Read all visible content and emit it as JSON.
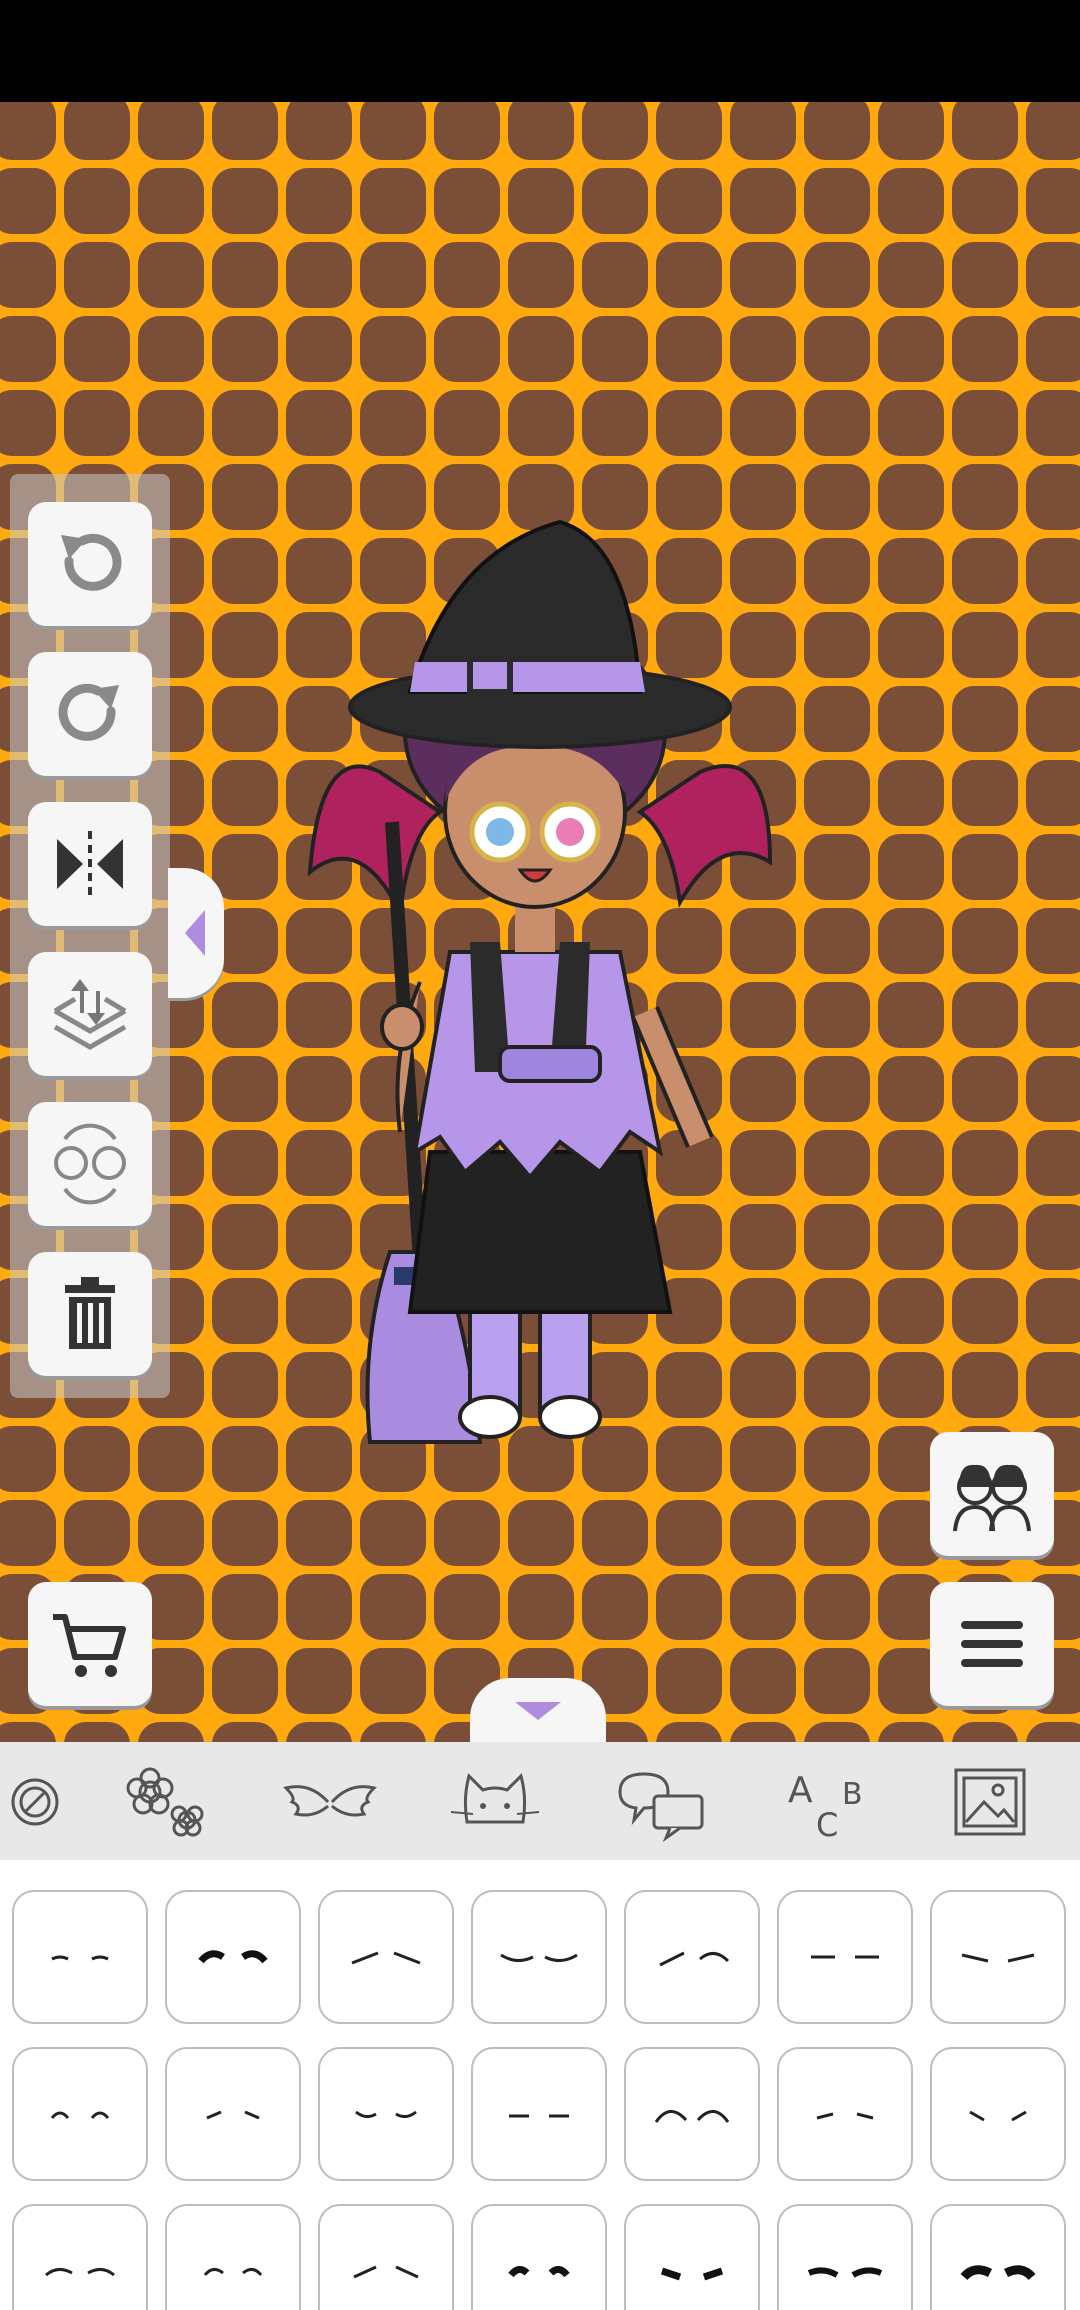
{
  "app": {
    "screen": "character-editor"
  },
  "toolbar": {
    "tools": [
      {
        "name": "undo-button",
        "icon": "undo-icon"
      },
      {
        "name": "redo-button",
        "icon": "redo-icon"
      },
      {
        "name": "flip-button",
        "icon": "flip-horizontal-icon"
      },
      {
        "name": "layer-order-button",
        "icon": "layer-order-icon"
      },
      {
        "name": "swap-character-button",
        "icon": "swap-character-icon"
      },
      {
        "name": "delete-button",
        "icon": "trash-icon"
      }
    ]
  },
  "buttons": {
    "characters": "characters-icon",
    "shop": "cart-icon",
    "menu": "hamburger-menu-icon"
  },
  "categories": [
    {
      "icon": "circle-accessory-icon"
    },
    {
      "icon": "flowers-icon"
    },
    {
      "icon": "wings-icon"
    },
    {
      "icon": "cat-pet-icon"
    },
    {
      "icon": "speech-bubble-icon"
    },
    {
      "icon": "text-abc-icon"
    },
    {
      "icon": "background-image-icon"
    }
  ],
  "eyebrow_grid": {
    "rows": 3,
    "columns": 7,
    "item": "eyebrow-option"
  },
  "colors": {
    "canvas_background": "#FFA90F",
    "tile": "#7A4E37",
    "panel": "#f6f6f6",
    "accent_purple": "#B08CE0"
  }
}
